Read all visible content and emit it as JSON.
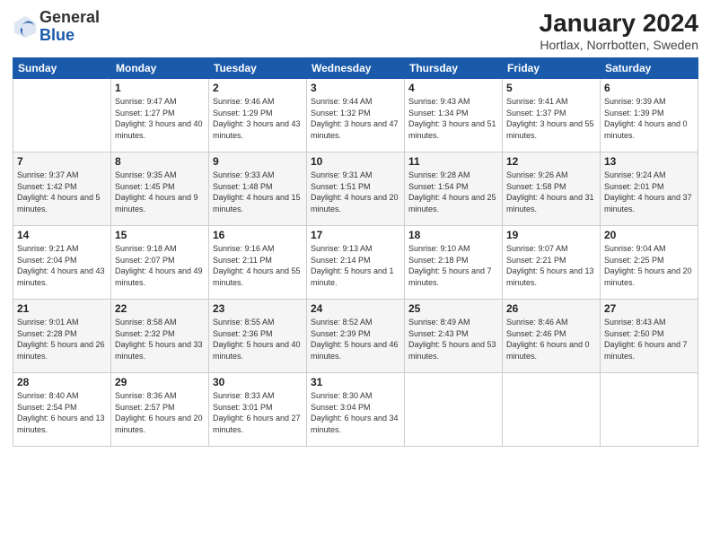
{
  "header": {
    "logo_general": "General",
    "logo_blue": "Blue",
    "month_title": "January 2024",
    "location": "Hortlax, Norrbotten, Sweden"
  },
  "days_of_week": [
    "Sunday",
    "Monday",
    "Tuesday",
    "Wednesday",
    "Thursday",
    "Friday",
    "Saturday"
  ],
  "weeks": [
    [
      {
        "day": "",
        "info": ""
      },
      {
        "day": "1",
        "info": "Sunrise: 9:47 AM\nSunset: 1:27 PM\nDaylight: 3 hours\nand 40 minutes."
      },
      {
        "day": "2",
        "info": "Sunrise: 9:46 AM\nSunset: 1:29 PM\nDaylight: 3 hours\nand 43 minutes."
      },
      {
        "day": "3",
        "info": "Sunrise: 9:44 AM\nSunset: 1:32 PM\nDaylight: 3 hours\nand 47 minutes."
      },
      {
        "day": "4",
        "info": "Sunrise: 9:43 AM\nSunset: 1:34 PM\nDaylight: 3 hours\nand 51 minutes."
      },
      {
        "day": "5",
        "info": "Sunrise: 9:41 AM\nSunset: 1:37 PM\nDaylight: 3 hours\nand 55 minutes."
      },
      {
        "day": "6",
        "info": "Sunrise: 9:39 AM\nSunset: 1:39 PM\nDaylight: 4 hours\nand 0 minutes."
      }
    ],
    [
      {
        "day": "7",
        "info": "Sunrise: 9:37 AM\nSunset: 1:42 PM\nDaylight: 4 hours\nand 5 minutes."
      },
      {
        "day": "8",
        "info": "Sunrise: 9:35 AM\nSunset: 1:45 PM\nDaylight: 4 hours\nand 9 minutes."
      },
      {
        "day": "9",
        "info": "Sunrise: 9:33 AM\nSunset: 1:48 PM\nDaylight: 4 hours\nand 15 minutes."
      },
      {
        "day": "10",
        "info": "Sunrise: 9:31 AM\nSunset: 1:51 PM\nDaylight: 4 hours\nand 20 minutes."
      },
      {
        "day": "11",
        "info": "Sunrise: 9:28 AM\nSunset: 1:54 PM\nDaylight: 4 hours\nand 25 minutes."
      },
      {
        "day": "12",
        "info": "Sunrise: 9:26 AM\nSunset: 1:58 PM\nDaylight: 4 hours\nand 31 minutes."
      },
      {
        "day": "13",
        "info": "Sunrise: 9:24 AM\nSunset: 2:01 PM\nDaylight: 4 hours\nand 37 minutes."
      }
    ],
    [
      {
        "day": "14",
        "info": "Sunrise: 9:21 AM\nSunset: 2:04 PM\nDaylight: 4 hours\nand 43 minutes."
      },
      {
        "day": "15",
        "info": "Sunrise: 9:18 AM\nSunset: 2:07 PM\nDaylight: 4 hours\nand 49 minutes."
      },
      {
        "day": "16",
        "info": "Sunrise: 9:16 AM\nSunset: 2:11 PM\nDaylight: 4 hours\nand 55 minutes."
      },
      {
        "day": "17",
        "info": "Sunrise: 9:13 AM\nSunset: 2:14 PM\nDaylight: 5 hours\nand 1 minute."
      },
      {
        "day": "18",
        "info": "Sunrise: 9:10 AM\nSunset: 2:18 PM\nDaylight: 5 hours\nand 7 minutes."
      },
      {
        "day": "19",
        "info": "Sunrise: 9:07 AM\nSunset: 2:21 PM\nDaylight: 5 hours\nand 13 minutes."
      },
      {
        "day": "20",
        "info": "Sunrise: 9:04 AM\nSunset: 2:25 PM\nDaylight: 5 hours\nand 20 minutes."
      }
    ],
    [
      {
        "day": "21",
        "info": "Sunrise: 9:01 AM\nSunset: 2:28 PM\nDaylight: 5 hours\nand 26 minutes."
      },
      {
        "day": "22",
        "info": "Sunrise: 8:58 AM\nSunset: 2:32 PM\nDaylight: 5 hours\nand 33 minutes."
      },
      {
        "day": "23",
        "info": "Sunrise: 8:55 AM\nSunset: 2:36 PM\nDaylight: 5 hours\nand 40 minutes."
      },
      {
        "day": "24",
        "info": "Sunrise: 8:52 AM\nSunset: 2:39 PM\nDaylight: 5 hours\nand 46 minutes."
      },
      {
        "day": "25",
        "info": "Sunrise: 8:49 AM\nSunset: 2:43 PM\nDaylight: 5 hours\nand 53 minutes."
      },
      {
        "day": "26",
        "info": "Sunrise: 8:46 AM\nSunset: 2:46 PM\nDaylight: 6 hours\nand 0 minutes."
      },
      {
        "day": "27",
        "info": "Sunrise: 8:43 AM\nSunset: 2:50 PM\nDaylight: 6 hours\nand 7 minutes."
      }
    ],
    [
      {
        "day": "28",
        "info": "Sunrise: 8:40 AM\nSunset: 2:54 PM\nDaylight: 6 hours\nand 13 minutes."
      },
      {
        "day": "29",
        "info": "Sunrise: 8:36 AM\nSunset: 2:57 PM\nDaylight: 6 hours\nand 20 minutes."
      },
      {
        "day": "30",
        "info": "Sunrise: 8:33 AM\nSunset: 3:01 PM\nDaylight: 6 hours\nand 27 minutes."
      },
      {
        "day": "31",
        "info": "Sunrise: 8:30 AM\nSunset: 3:04 PM\nDaylight: 6 hours\nand 34 minutes."
      },
      {
        "day": "",
        "info": ""
      },
      {
        "day": "",
        "info": ""
      },
      {
        "day": "",
        "info": ""
      }
    ]
  ]
}
